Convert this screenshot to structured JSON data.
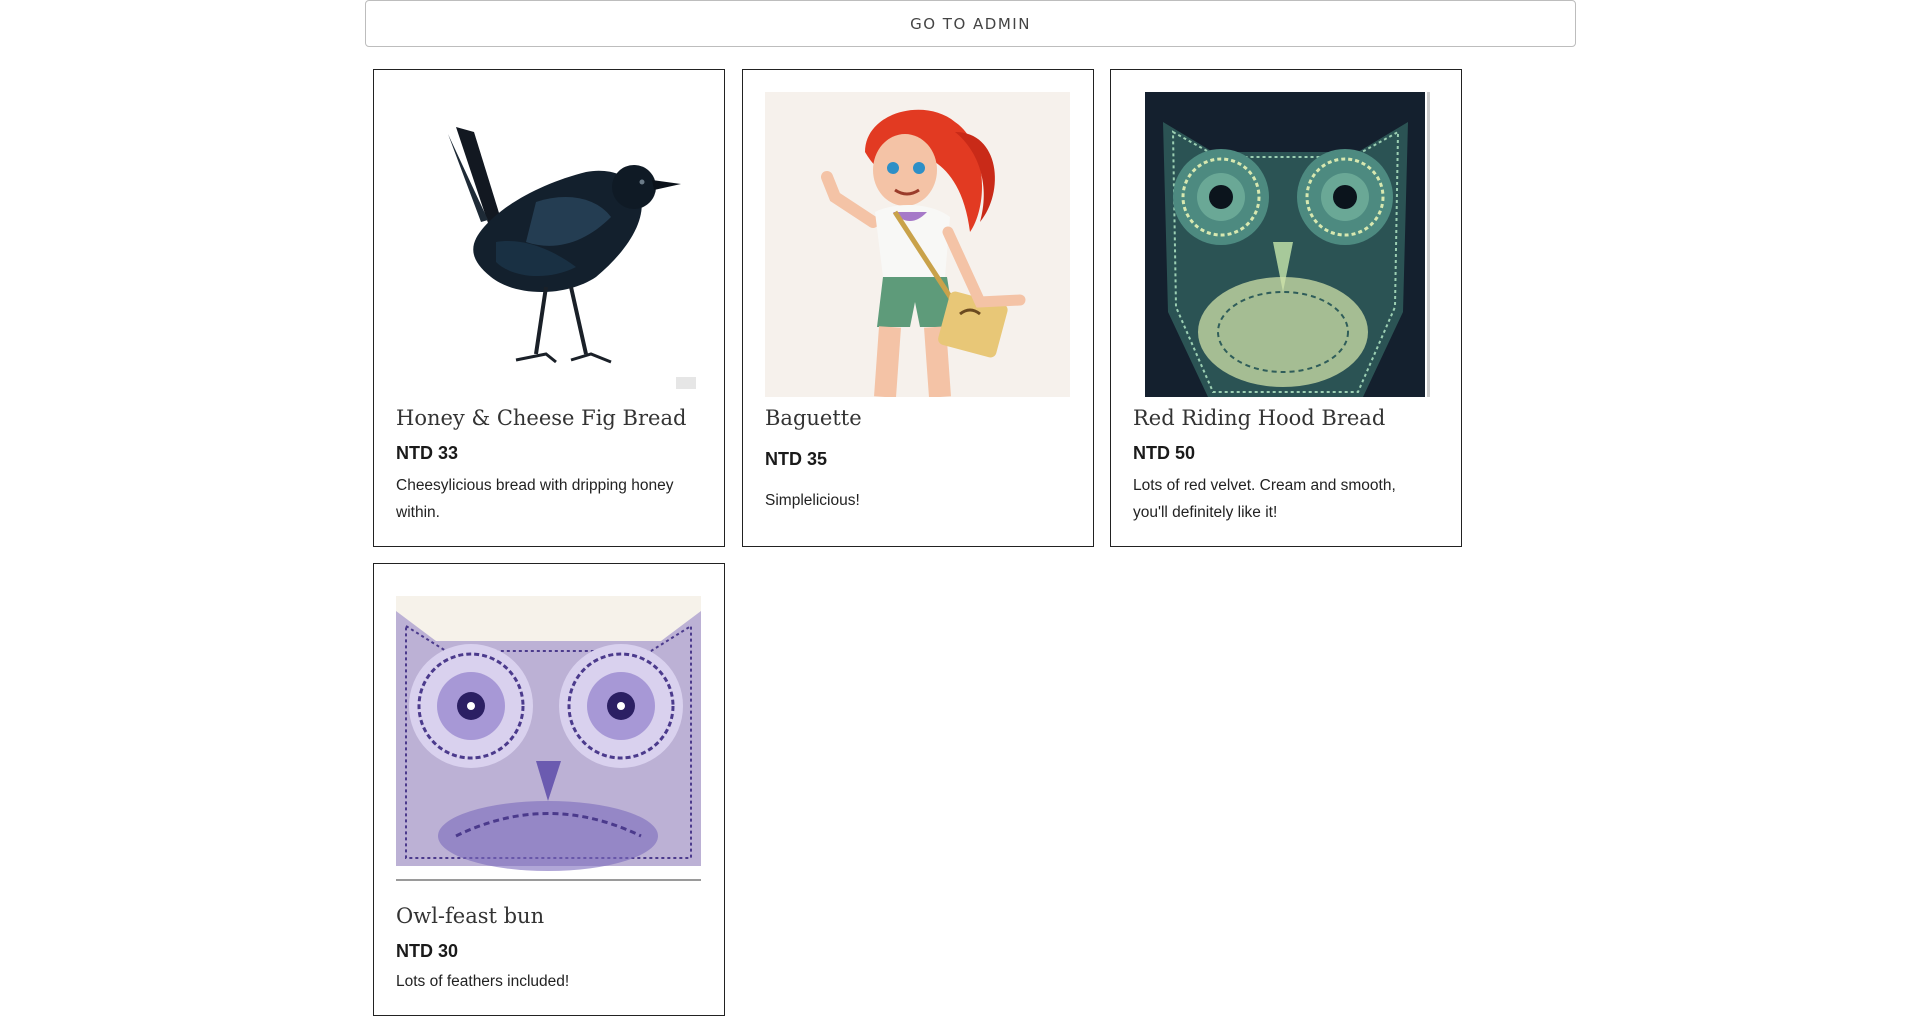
{
  "header": {
    "admin_button_label": "GO TO ADMIN"
  },
  "products": [
    {
      "title": "Honey & Cheese Fig Bread",
      "price": "NTD 33",
      "description": "Cheesylicious bread with dripping honey within.",
      "image": "blackbird-painting"
    },
    {
      "title": "Baguette",
      "price": "NTD 35",
      "description": "Simplelicious!",
      "image": "red-haired-girl-illustration"
    },
    {
      "title": "Red Riding Hood Bread",
      "price": "NTD 50",
      "description": "Lots of red velvet. Cream and smooth, you'll definitely like it!",
      "image": "teal-mandala-owl"
    },
    {
      "title": "Owl-feast bun",
      "price": "NTD 30",
      "description": "Lots of feathers included!",
      "image": "purple-mandala-owl"
    }
  ],
  "colors": {
    "card_border": "#222222",
    "button_border": "#bdbdbd",
    "teal_owl_bg": "#14202e",
    "purple_owl": "#4b3a8c"
  }
}
